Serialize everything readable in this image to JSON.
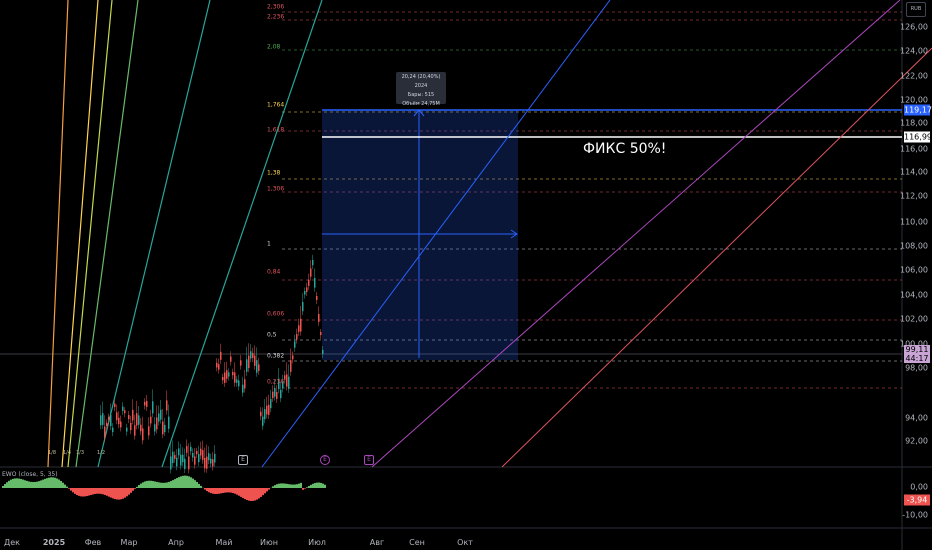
{
  "currency_button": "RUB",
  "price_axis": [
    "126,00",
    "124,00",
    "122,00",
    "120,00",
    "118,00",
    "116,00",
    "114,00",
    "112,00",
    "110,00",
    "108,00",
    "106,00",
    "104,00",
    "102,00",
    "100,00",
    "98,00",
    "94,00",
    "92,00"
  ],
  "price_tags": {
    "upper": {
      "value": "119,17",
      "color": "#2962ff"
    },
    "fix": {
      "value": "116,99",
      "color": "#ffffff"
    },
    "last": {
      "value": "99,11",
      "sub": "44:17",
      "color": "#c9a5d6"
    }
  },
  "fib_levels": [
    {
      "label": "2,306",
      "color": "#e05560"
    },
    {
      "label": "2,236",
      "color": "#e05560"
    },
    {
      "label": "2,08",
      "color": "#4caf50"
    },
    {
      "label": "1,764",
      "color": "#ffd54f"
    },
    {
      "label": "1,618",
      "color": "#e05560"
    },
    {
      "label": "1,38",
      "color": "#ffd54f"
    },
    {
      "label": "1,306",
      "color": "#e05560"
    },
    {
      "label": "1",
      "color": "#d1d4dc"
    },
    {
      "label": "0,84",
      "color": "#e05560"
    },
    {
      "label": "0,606",
      "color": "#e05560"
    },
    {
      "label": "0,5",
      "color": "#d1d4dc"
    },
    {
      "label": "0,382",
      "color": "#d1d4dc"
    },
    {
      "label": "0,236",
      "color": "#e05560"
    }
  ],
  "measure_box": {
    "line1": "20,24 (20,40%) 2024",
    "line2": "Бары: 515",
    "line3": "Объём 24,75М"
  },
  "fix_label": "ФИКС 50%!",
  "time_axis": [
    "Дек",
    "2025",
    "Фев",
    "Мар",
    "Апр",
    "Май",
    "Июн",
    "Июл",
    "Авг",
    "Сен",
    "Окт"
  ],
  "fan_labels": [
    "1/8",
    "1/4",
    "1/3",
    "1/2"
  ],
  "event_markers": [
    "E",
    "E",
    "E"
  ],
  "oscillator": {
    "label": "EWO (close, 5, 35)",
    "axis": [
      "0,00",
      "-10,00"
    ],
    "value_tag": "-3,94"
  }
}
